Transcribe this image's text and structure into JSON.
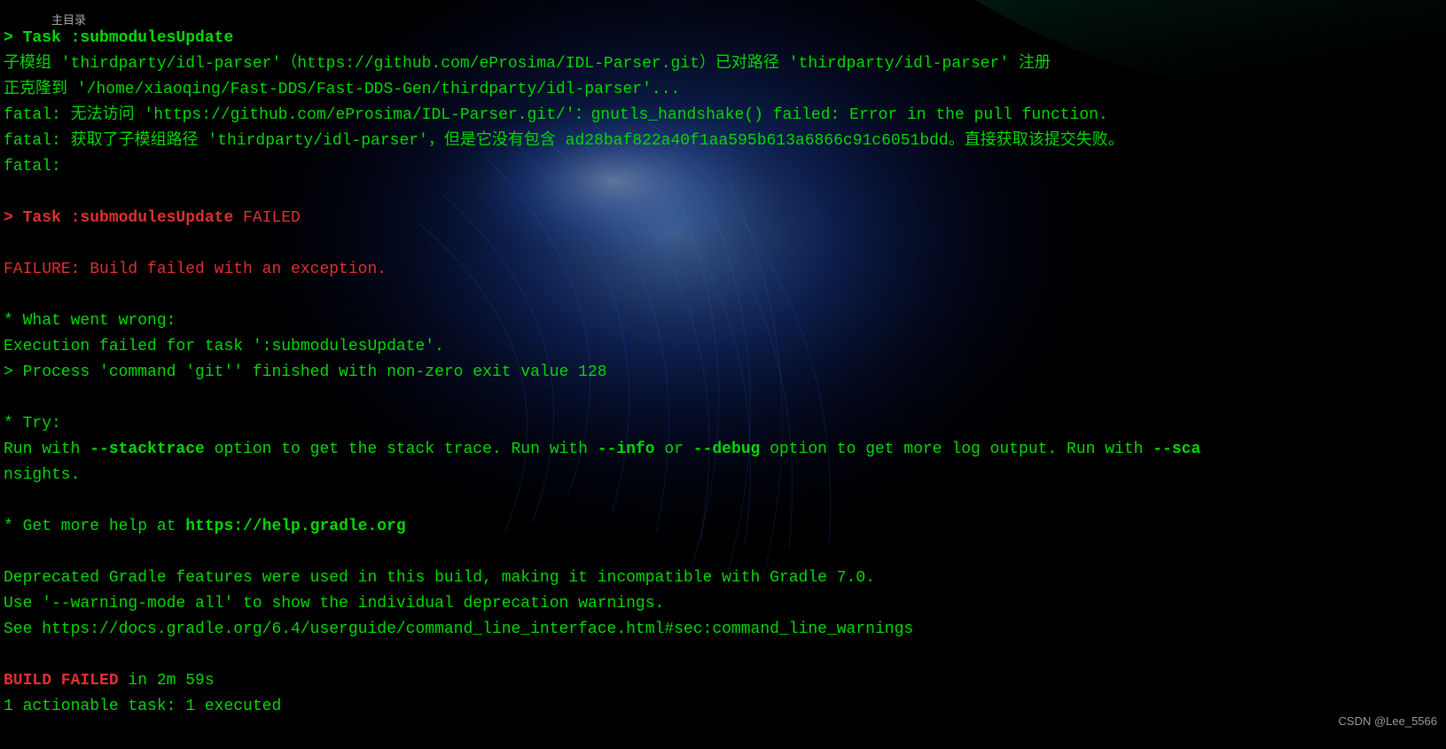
{
  "watermarks": {
    "toc": "主目录",
    "csdn": "CSDN @Lee_5566"
  },
  "lines": {
    "l0_prefix": "> Task :submodulesUpdate",
    "l1": "子模组 'thirdparty/idl-parser'（https://github.com/eProsima/IDL-Parser.git）已对路径 'thirdparty/idl-parser' 注册",
    "l2": "正克隆到 '/home/xiaoqing/Fast-DDS/Fast-DDS-Gen/thirdparty/idl-parser'...",
    "l3": "fatal: 无法访问 'https://github.com/eProsima/IDL-Parser.git/'：gnutls_handshake() failed: Error in the pull function.",
    "l4": "fatal: 获取了子模组路径 'thirdparty/idl-parser'，但是它没有包含 ad28baf822a40f1aa595b613a6866c91c6051bdd。直接获取该提交失败。",
    "l5": "fatal:",
    "l6_prefix": "> Task :submodulesUpdate",
    "l6_failed": " FAILED",
    "l7": "FAILURE: Build failed with an exception.",
    "l8": "* What went wrong:",
    "l9": "Execution failed for task ':submodulesUpdate'.",
    "l10": "> Process 'command 'git'' finished with non-zero exit value 128",
    "l11": "* Try:",
    "l12_a": "Run with ",
    "l12_b": "--stacktrace",
    "l12_c": " option to get the stack trace. Run with ",
    "l12_d": "--info",
    "l12_e": " or ",
    "l12_f": "--debug",
    "l12_g": " option to get more log output. Run with ",
    "l12_h": "--sca",
    "l13": "nsights.",
    "l14_a": "* Get more help at ",
    "l14_b": "https://help.gradle.org",
    "l15": "Deprecated Gradle features were used in this build, making it incompatible with Gradle 7.0.",
    "l16": "Use '--warning-mode all' to show the individual deprecation warnings.",
    "l17": "See https://docs.gradle.org/6.4/userguide/command_line_interface.html#sec:command_line_warnings",
    "l18_a": "BUILD FAILED",
    "l18_b": " in 2m 59s",
    "l19": "1 actionable task: 1 executed"
  }
}
